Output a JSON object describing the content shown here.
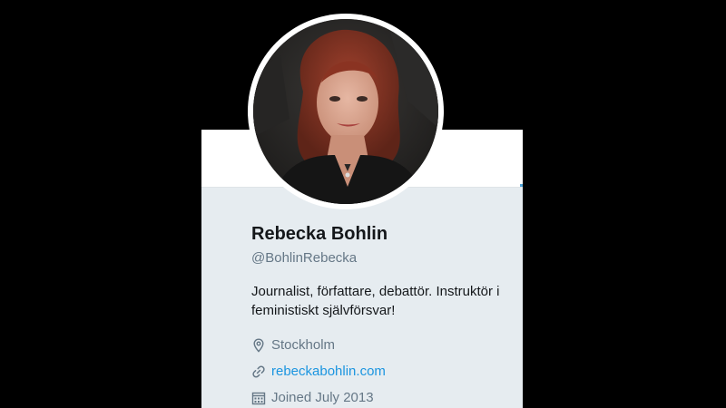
{
  "profile": {
    "display_name": "Rebecka Bohlin",
    "handle": "@BohlinRebecka",
    "bio_line_1": "Journalist, författare, debattör. Instruktör i",
    "bio_line_2": "feministiskt självförsvar!",
    "location": "Stockholm",
    "website": "rebeckabohlin.com",
    "joined": "Joined July 2013"
  },
  "icons": {
    "location": "location-pin-icon",
    "website": "link-icon",
    "joined": "calendar-icon"
  },
  "colors": {
    "background": "#000000",
    "card": "#e6ecf0",
    "name": "#14171a",
    "secondary_text": "#657786",
    "link": "#1b95e0"
  }
}
